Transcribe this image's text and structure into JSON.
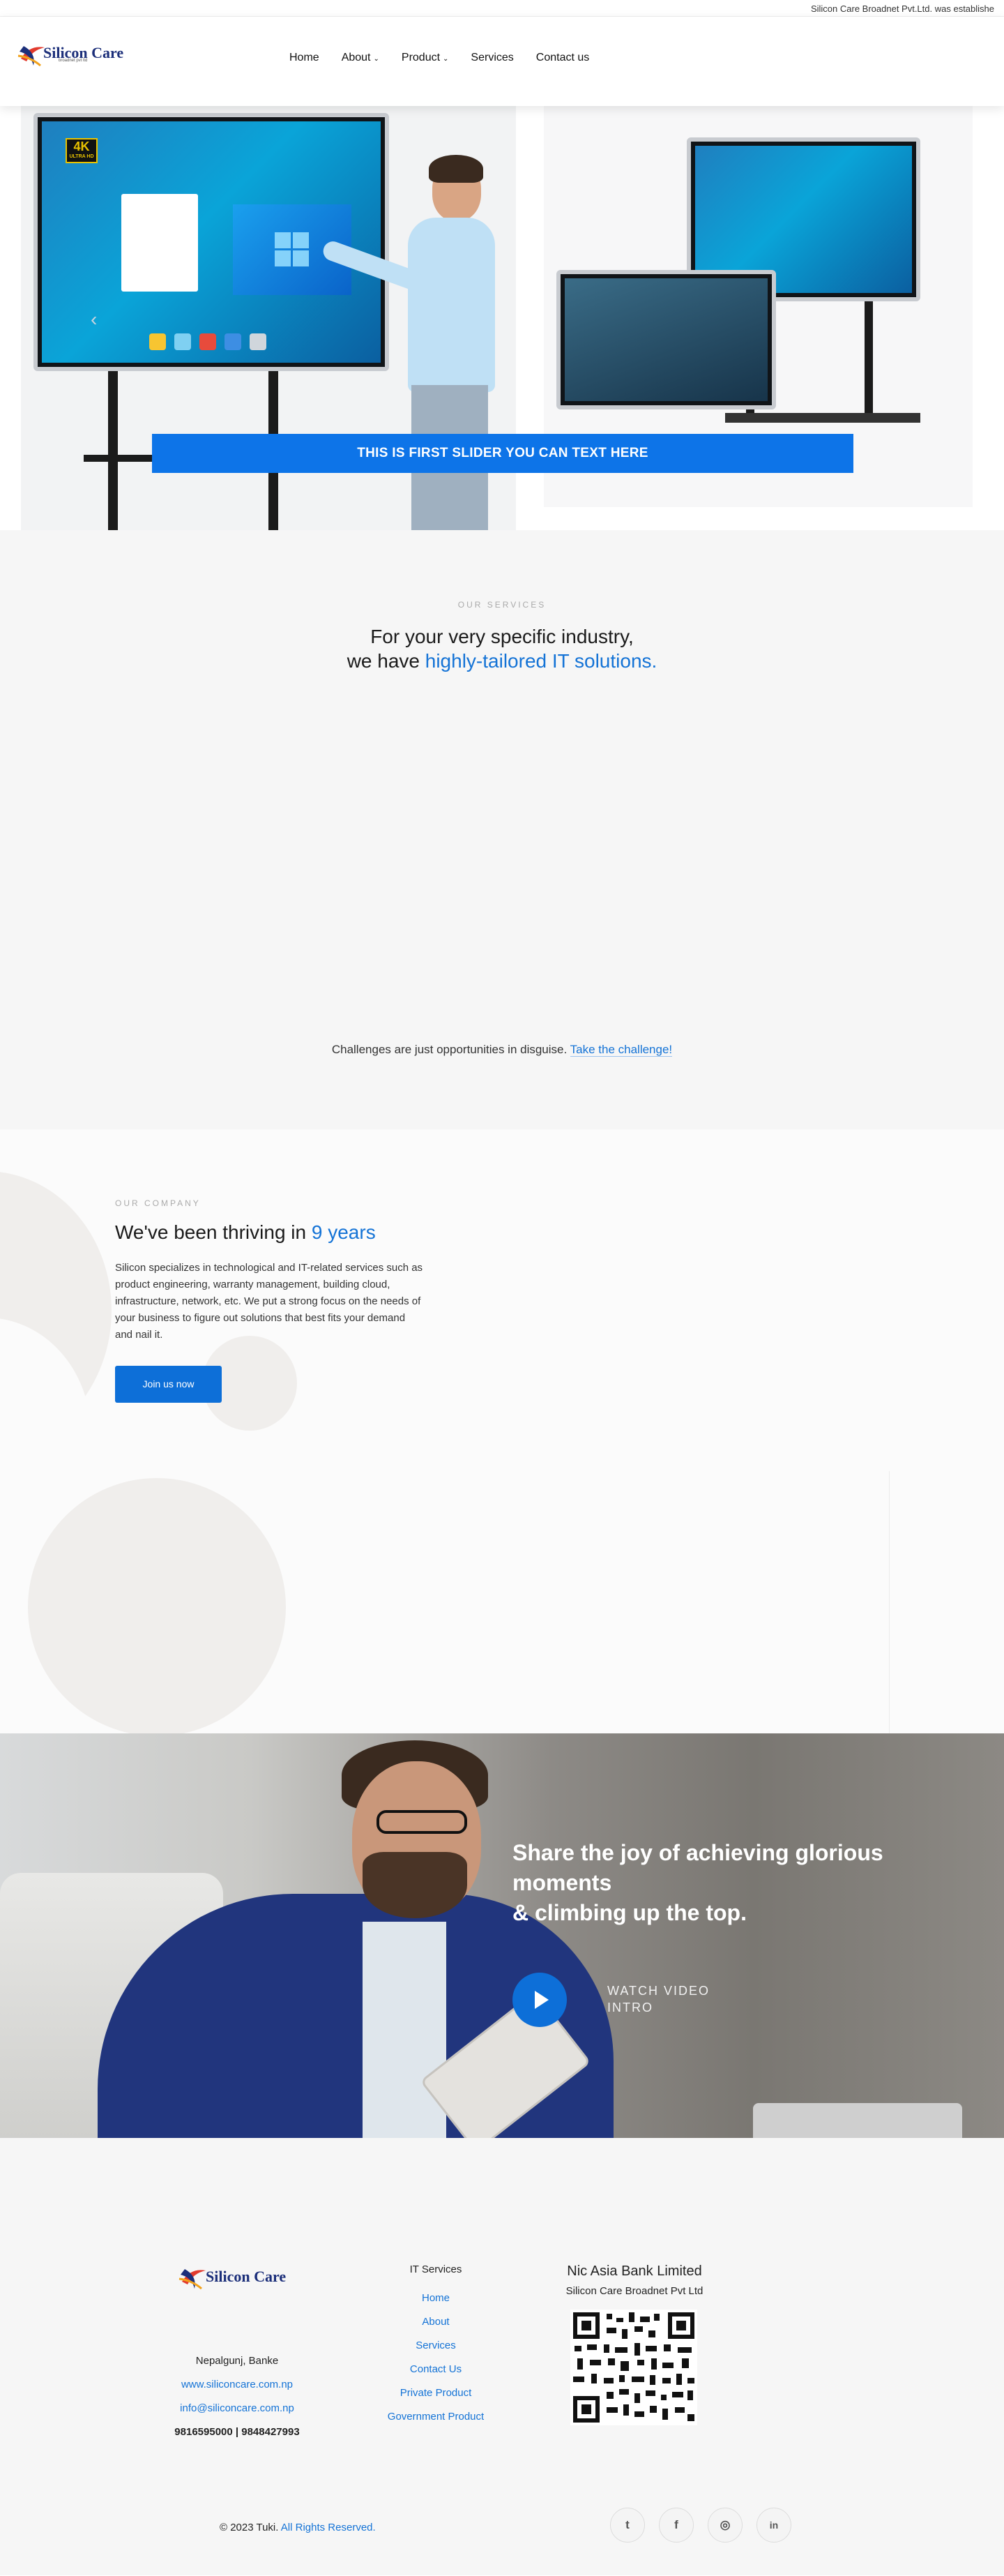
{
  "topbar": {
    "ticker": "Silicon Care Broadnet Pvt.Ltd. was establishe"
  },
  "brand": {
    "name": "Silicon Care",
    "tagline": "broadnet pvt ltd"
  },
  "nav": [
    {
      "label": "Home",
      "dropdown": false
    },
    {
      "label": "About",
      "dropdown": true
    },
    {
      "label": "Product",
      "dropdown": true
    },
    {
      "label": "Services",
      "dropdown": false
    },
    {
      "label": "Contact us",
      "dropdown": false
    }
  ],
  "hero": {
    "badge": "4K",
    "badge_sub": "ULTRA HD",
    "caption": "THIS IS FIRST SLIDER YOU CAN TEXT HERE"
  },
  "services": {
    "eyebrow": "OUR SERVICES",
    "heading_line1": "For your very specific industry,",
    "heading_line2_prefix": "we have ",
    "heading_line2_accent": "highly-tailored IT solutions",
    "heading_line2_suffix": ".",
    "challenge_text": "Challenges are just opportunities in disguise. ",
    "challenge_link": "Take the challenge!"
  },
  "company": {
    "eyebrow": "OUR COMPANY",
    "heading_prefix": "We've been thriving in ",
    "heading_accent": "9 years",
    "body": "Silicon specializes in technological and IT-related services such as product engineering, warranty management, building cloud, infrastructure, network, etc. We put a strong focus on the needs of your business to figure out solutions that best fits your demand and nail it.",
    "button": "Join us now"
  },
  "video": {
    "heading_line1": "Share the joy of achieving glorious",
    "heading_line2": "moments",
    "heading_line3": "& climbing up the top.",
    "watch_line1": "WATCH VIDEO",
    "watch_line2": "INTRO"
  },
  "footer": {
    "address": "Nepalgunj, Banke",
    "website": "www.siliconcare.com.np",
    "email": "info@siliconcare.com.np",
    "phones": "9816595000 | 9848427993",
    "links_heading": "IT Services",
    "links": [
      "Home",
      "About",
      "Services",
      "Contact Us",
      "Private Product",
      "Government Product"
    ],
    "bank_name": "Nic Asia Bank Limited",
    "account_name": "Silicon Care Broadnet Pvt Ltd",
    "copyright": "© 2023 Tuki. ",
    "rights": "All Rights Reserved.",
    "socials": [
      {
        "name": "twitter-icon",
        "glyph": "t"
      },
      {
        "name": "facebook-icon",
        "glyph": "f"
      },
      {
        "name": "instagram-icon",
        "glyph": "◎"
      },
      {
        "name": "linkedin-icon",
        "glyph": "in"
      }
    ]
  },
  "colors": {
    "accent": "#1473d6",
    "button": "#0d6fd8",
    "caption_bg": "#0d74e8"
  }
}
